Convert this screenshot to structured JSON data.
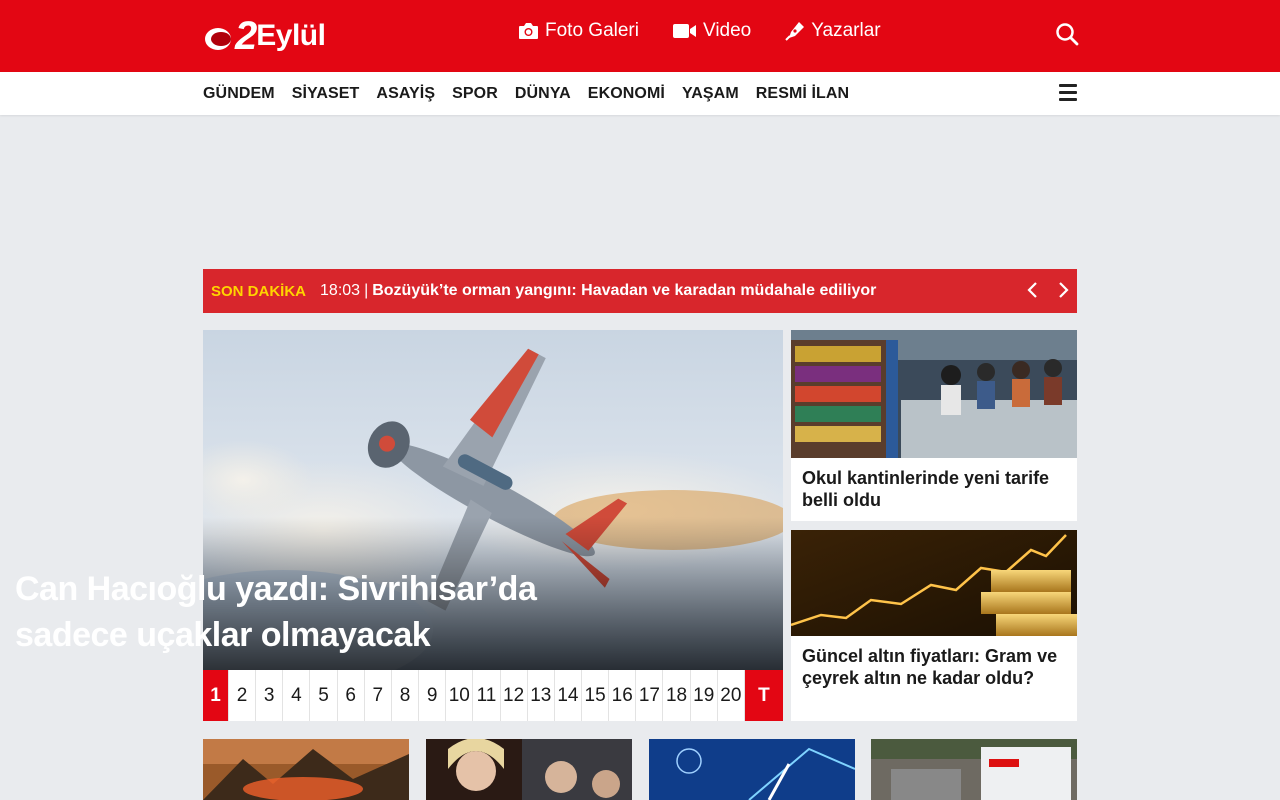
{
  "header": {
    "logo_number": "2",
    "logo_word": "Eylül",
    "nav": [
      {
        "label": "Foto Galeri",
        "icon": "camera-icon"
      },
      {
        "label": "Video",
        "icon": "video-camera-icon"
      },
      {
        "label": "Yazarlar",
        "icon": "pen-icon"
      }
    ]
  },
  "categories": [
    "GÜNDEM",
    "SİYASET",
    "ASAYİŞ",
    "SPOR",
    "DÜNYA",
    "EKONOMİ",
    "YAŞAM",
    "RESMİ İLAN"
  ],
  "breaking": {
    "tag": "SON DAKİKA",
    "time": "18:03",
    "separator": "|",
    "headline": "Bozüyük’te orman yangını: Havadan ve karadan müdahale ediliyor"
  },
  "slider": {
    "title": "Can Hacıoğlu yazdı: Sivrihisar’da sadece uçaklar olmayacak",
    "pages": [
      "1",
      "2",
      "3",
      "4",
      "5",
      "6",
      "7",
      "8",
      "9",
      "10",
      "11",
      "12",
      "13",
      "14",
      "15",
      "16",
      "17",
      "18",
      "19",
      "20"
    ],
    "active_page": "1",
    "all_label": "T"
  },
  "side_cards": [
    {
      "title": "Okul kantinlerinde yeni tarife belli oldu"
    },
    {
      "title": "Güncel altın fiyatları: Gram ve çeyrek altın ne kadar oldu?"
    }
  ],
  "colors": {
    "brand_red": "#e30613",
    "breaking_red": "#d8262c",
    "breaking_tag": "#ffd400",
    "page_bg": "#e9ebee"
  }
}
